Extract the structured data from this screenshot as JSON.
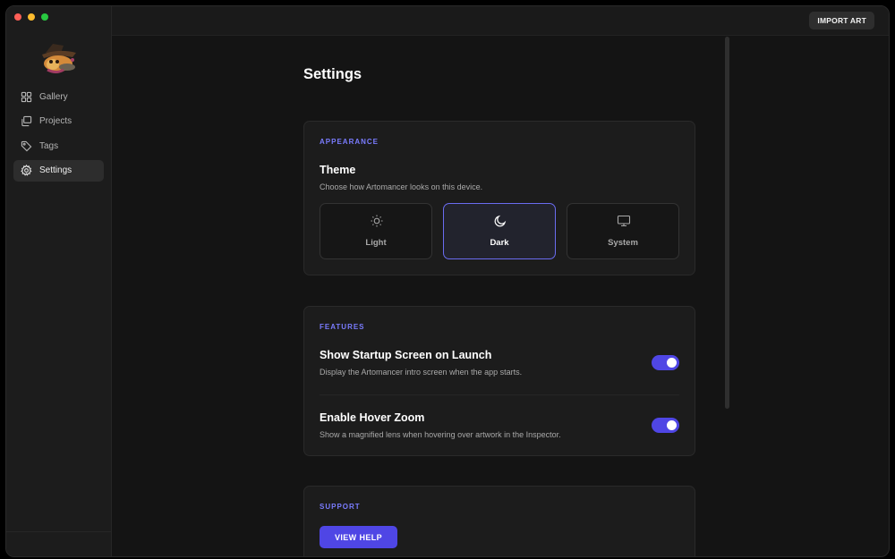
{
  "sidebar": {
    "items": [
      {
        "label": "Gallery",
        "icon": "grid-icon"
      },
      {
        "label": "Projects",
        "icon": "folders-icon"
      },
      {
        "label": "Tags",
        "icon": "tag-icon"
      },
      {
        "label": "Settings",
        "icon": "gear-icon",
        "active": true
      }
    ]
  },
  "topbar": {
    "import_label": "IMPORT ART"
  },
  "page": {
    "title": "Settings"
  },
  "appearance": {
    "section_label": "APPEARANCE",
    "theme_title": "Theme",
    "theme_desc": "Choose how Artomancer looks on this device.",
    "options": [
      {
        "label": "Light",
        "icon": "sun-icon"
      },
      {
        "label": "Dark",
        "icon": "moon-icon",
        "selected": true
      },
      {
        "label": "System",
        "icon": "monitor-icon"
      }
    ]
  },
  "features": {
    "section_label": "FEATURES",
    "items": [
      {
        "title": "Show Startup Screen on Launch",
        "desc": "Display the Artomancer intro screen when the app starts.",
        "enabled": true
      },
      {
        "title": "Enable Hover Zoom",
        "desc": "Show a magnified lens when hovering over artwork in the Inspector.",
        "enabled": true
      }
    ]
  },
  "support": {
    "section_label": "SUPPORT",
    "help_label": "VIEW HELP"
  },
  "colors": {
    "accent": "#4f46e5",
    "accent_label": "#7a7cff",
    "background": "#141414",
    "card": "#1c1c1c"
  }
}
